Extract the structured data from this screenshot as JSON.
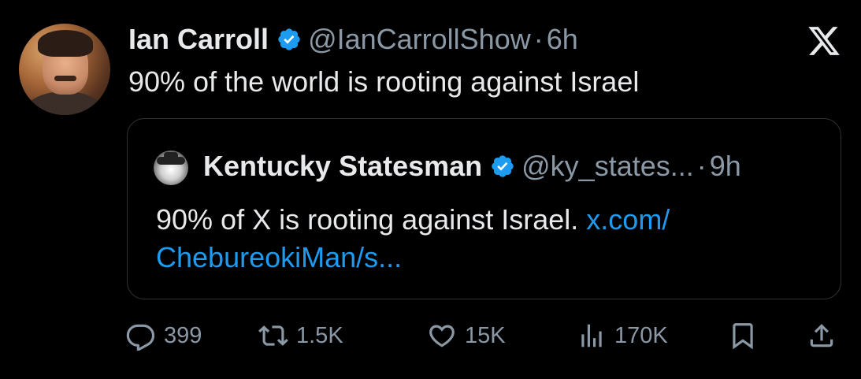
{
  "tweet": {
    "author_name": "Ian Carroll",
    "handle": "@IanCarrollShow",
    "separator": "·",
    "time": "6h",
    "text": "90% of the world is rooting against Israel",
    "verified_icon": "verified-badge-icon",
    "platform_icon": "x-logo-icon"
  },
  "quote": {
    "author_name": "Kentucky Statesman",
    "handle": "@ky_states...",
    "separator": "·",
    "time": "9h",
    "text": "90% of X is rooting against Israel. ",
    "link_line1": "x.com/",
    "link_line2": "ChebureokiMan/s..."
  },
  "actions": {
    "reply_count": "399",
    "repost_count": "1.5K",
    "like_count": "15K",
    "views_count": "170K"
  },
  "colors": {
    "background": "#000000",
    "text": "#e7e9ea",
    "secondary": "#8b98a5",
    "link": "#1d9bf0",
    "verified": "#1d9bf0",
    "border": "#2f3336"
  }
}
